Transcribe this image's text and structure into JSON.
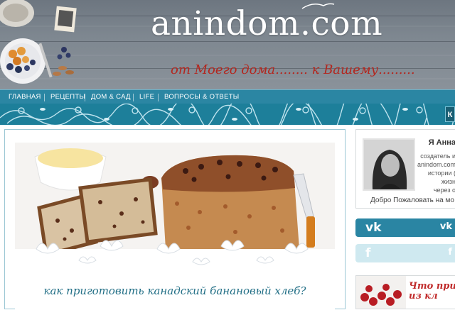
{
  "header": {
    "site_title": "anindom.com",
    "tagline": "от Моего дома........ к Вашему........."
  },
  "nav": {
    "items": [
      {
        "label": "ГЛАВНАЯ"
      },
      {
        "label": "РЕЦЕПТЫ"
      },
      {
        "label": "ДОМ & САД"
      },
      {
        "label": "LIFE"
      },
      {
        "label": "ВОПРОСЫ & ОТВЕТЫ"
      }
    ]
  },
  "banner": {
    "button_label": "К"
  },
  "feature": {
    "caption": "как приготовить канадский банановый хлеб?"
  },
  "sidebar": {
    "about": {
      "name": "Я Анна",
      "lines": [
        "создатель и",
        "anindom.com",
        "истории (",
        "жизн",
        "через о"
      ],
      "welcome": "Добро Пожаловать на мо"
    },
    "social": {
      "vk_icon": "vk-icon",
      "fb_icon": "facebook-icon"
    },
    "promo": {
      "line1": "Что при",
      "line2": "из кл"
    }
  },
  "colors": {
    "nav_bg": "#2b86a3",
    "banner_bg": "#1d7f9a",
    "tagline": "#b3261e",
    "caption": "#226f86",
    "promo": "#c02b2b"
  }
}
